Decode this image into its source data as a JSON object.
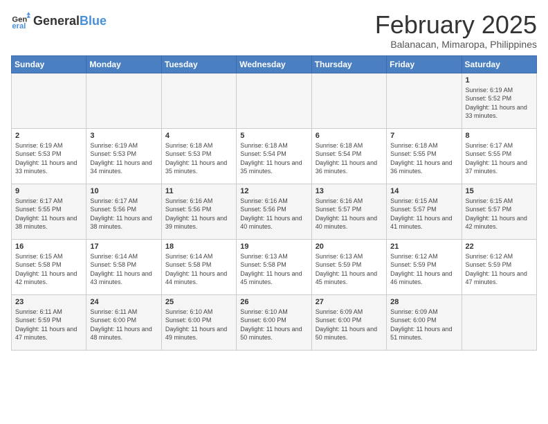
{
  "header": {
    "logo_general": "General",
    "logo_blue": "Blue",
    "title": "February 2025",
    "subtitle": "Balanacan, Mimaropa, Philippines"
  },
  "weekdays": [
    "Sunday",
    "Monday",
    "Tuesday",
    "Wednesday",
    "Thursday",
    "Friday",
    "Saturday"
  ],
  "weeks": [
    [
      {
        "day": "",
        "info": ""
      },
      {
        "day": "",
        "info": ""
      },
      {
        "day": "",
        "info": ""
      },
      {
        "day": "",
        "info": ""
      },
      {
        "day": "",
        "info": ""
      },
      {
        "day": "",
        "info": ""
      },
      {
        "day": "1",
        "info": "Sunrise: 6:19 AM\nSunset: 5:52 PM\nDaylight: 11 hours and 33 minutes."
      }
    ],
    [
      {
        "day": "2",
        "info": "Sunrise: 6:19 AM\nSunset: 5:53 PM\nDaylight: 11 hours and 33 minutes."
      },
      {
        "day": "3",
        "info": "Sunrise: 6:19 AM\nSunset: 5:53 PM\nDaylight: 11 hours and 34 minutes."
      },
      {
        "day": "4",
        "info": "Sunrise: 6:18 AM\nSunset: 5:53 PM\nDaylight: 11 hours and 35 minutes."
      },
      {
        "day": "5",
        "info": "Sunrise: 6:18 AM\nSunset: 5:54 PM\nDaylight: 11 hours and 35 minutes."
      },
      {
        "day": "6",
        "info": "Sunrise: 6:18 AM\nSunset: 5:54 PM\nDaylight: 11 hours and 36 minutes."
      },
      {
        "day": "7",
        "info": "Sunrise: 6:18 AM\nSunset: 5:55 PM\nDaylight: 11 hours and 36 minutes."
      },
      {
        "day": "8",
        "info": "Sunrise: 6:17 AM\nSunset: 5:55 PM\nDaylight: 11 hours and 37 minutes."
      }
    ],
    [
      {
        "day": "9",
        "info": "Sunrise: 6:17 AM\nSunset: 5:55 PM\nDaylight: 11 hours and 38 minutes."
      },
      {
        "day": "10",
        "info": "Sunrise: 6:17 AM\nSunset: 5:56 PM\nDaylight: 11 hours and 38 minutes."
      },
      {
        "day": "11",
        "info": "Sunrise: 6:16 AM\nSunset: 5:56 PM\nDaylight: 11 hours and 39 minutes."
      },
      {
        "day": "12",
        "info": "Sunrise: 6:16 AM\nSunset: 5:56 PM\nDaylight: 11 hours and 40 minutes."
      },
      {
        "day": "13",
        "info": "Sunrise: 6:16 AM\nSunset: 5:57 PM\nDaylight: 11 hours and 40 minutes."
      },
      {
        "day": "14",
        "info": "Sunrise: 6:15 AM\nSunset: 5:57 PM\nDaylight: 11 hours and 41 minutes."
      },
      {
        "day": "15",
        "info": "Sunrise: 6:15 AM\nSunset: 5:57 PM\nDaylight: 11 hours and 42 minutes."
      }
    ],
    [
      {
        "day": "16",
        "info": "Sunrise: 6:15 AM\nSunset: 5:58 PM\nDaylight: 11 hours and 42 minutes."
      },
      {
        "day": "17",
        "info": "Sunrise: 6:14 AM\nSunset: 5:58 PM\nDaylight: 11 hours and 43 minutes."
      },
      {
        "day": "18",
        "info": "Sunrise: 6:14 AM\nSunset: 5:58 PM\nDaylight: 11 hours and 44 minutes."
      },
      {
        "day": "19",
        "info": "Sunrise: 6:13 AM\nSunset: 5:58 PM\nDaylight: 11 hours and 45 minutes."
      },
      {
        "day": "20",
        "info": "Sunrise: 6:13 AM\nSunset: 5:59 PM\nDaylight: 11 hours and 45 minutes."
      },
      {
        "day": "21",
        "info": "Sunrise: 6:12 AM\nSunset: 5:59 PM\nDaylight: 11 hours and 46 minutes."
      },
      {
        "day": "22",
        "info": "Sunrise: 6:12 AM\nSunset: 5:59 PM\nDaylight: 11 hours and 47 minutes."
      }
    ],
    [
      {
        "day": "23",
        "info": "Sunrise: 6:11 AM\nSunset: 5:59 PM\nDaylight: 11 hours and 47 minutes."
      },
      {
        "day": "24",
        "info": "Sunrise: 6:11 AM\nSunset: 6:00 PM\nDaylight: 11 hours and 48 minutes."
      },
      {
        "day": "25",
        "info": "Sunrise: 6:10 AM\nSunset: 6:00 PM\nDaylight: 11 hours and 49 minutes."
      },
      {
        "day": "26",
        "info": "Sunrise: 6:10 AM\nSunset: 6:00 PM\nDaylight: 11 hours and 50 minutes."
      },
      {
        "day": "27",
        "info": "Sunrise: 6:09 AM\nSunset: 6:00 PM\nDaylight: 11 hours and 50 minutes."
      },
      {
        "day": "28",
        "info": "Sunrise: 6:09 AM\nSunset: 6:00 PM\nDaylight: 11 hours and 51 minutes."
      },
      {
        "day": "",
        "info": ""
      }
    ]
  ]
}
